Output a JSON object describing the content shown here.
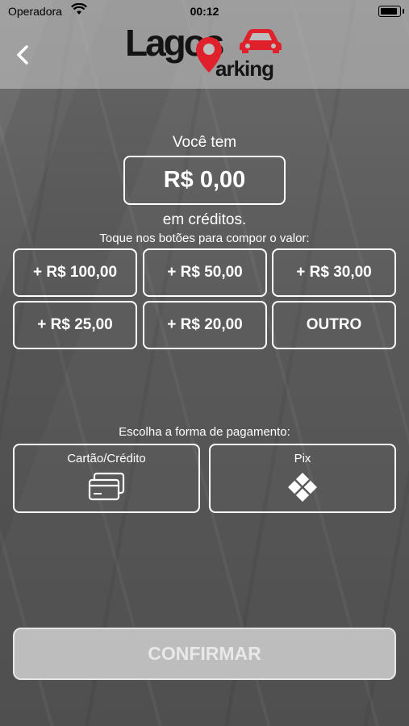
{
  "status_bar": {
    "carrier": "Operadora",
    "time": "00:12"
  },
  "logo": {
    "word1": "Lagos",
    "word2": "arking"
  },
  "balance": {
    "prefix": "Você tem",
    "amount": "R$ 0,00",
    "suffix": "em créditos.",
    "hint": "Toque nos botões para compor o valor:"
  },
  "amount_buttons": [
    "+ R$ 100,00",
    "+ R$ 50,00",
    "+ R$ 30,00",
    "+ R$ 25,00",
    "+ R$ 20,00",
    "OUTRO"
  ],
  "payment": {
    "prompt": "Escolha a forma de pagamento:",
    "options": [
      {
        "label": "Cartão/Crédito",
        "icon": "credit-card-icon"
      },
      {
        "label": "Pix",
        "icon": "pix-icon"
      }
    ]
  },
  "confirm_label": "CONFIRMAR",
  "colors": {
    "brand_red": "#e0202a",
    "confirm_bg": "#bdbdbd",
    "overlay": "#c8c8c8"
  }
}
